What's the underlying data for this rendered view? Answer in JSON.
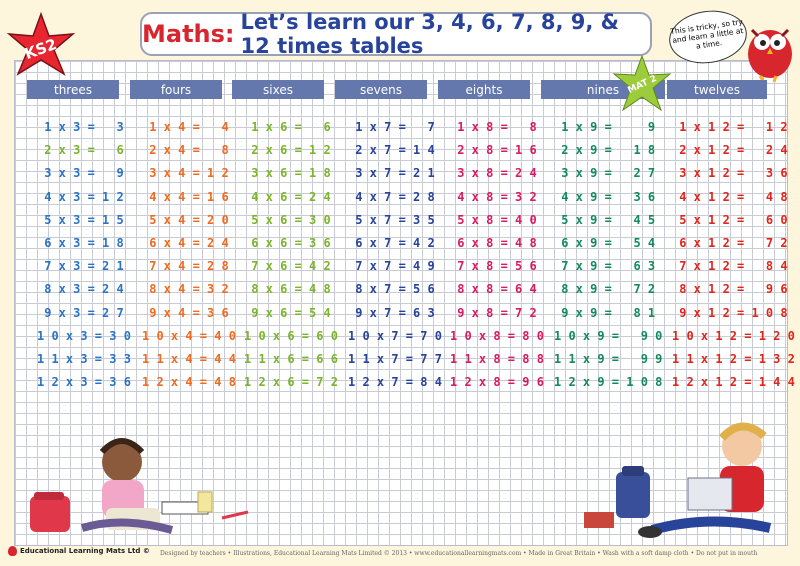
{
  "title": {
    "subject": "Maths:",
    "text": "Let’s learn our 3, 4, 6, 7, 8, 9, & 12 times tables"
  },
  "badge_ks2": "KS2",
  "badge_mat": "MAT 2",
  "owl_speech": "This is tricky, so try and learn a little at a time.",
  "brand": "Educational Learning Mats Ltd ©",
  "credits": "Designed by teachers • Illustrations, Educational Learning Mats Limited © 2013 • www.educationallearningmats.com • Made in Great Britain • Wash with a soft damp cloth • Do not put in mouth",
  "colors": {
    "blue": "#2b73c4",
    "orange": "#ef6b1f",
    "green": "#7ab52b",
    "navy": "#27439a",
    "magenta": "#d81b60",
    "teal": "#148a5c",
    "red": "#e0251b",
    "header": "#6478ad"
  },
  "columns": [
    {
      "header": "threes",
      "rows": [
        {
          "text": " 1 x 3 =   3",
          "color": "blue"
        },
        {
          "text": " 2 x 3 =   6",
          "color": "green"
        },
        {
          "text": " 3 x 3 =   9",
          "color": "blue"
        },
        {
          "text": " 4 x 3 = 1 2",
          "color": "blue"
        },
        {
          "text": " 5 x 3 = 1 5",
          "color": "blue"
        },
        {
          "text": " 6 x 3 = 1 8",
          "color": "blue"
        },
        {
          "text": " 7 x 3 = 2 1",
          "color": "blue"
        },
        {
          "text": " 8 x 3 = 2 4",
          "color": "blue"
        },
        {
          "text": " 9 x 3 = 2 7",
          "color": "blue"
        },
        {
          "text": "1 0 x 3 = 3 0",
          "color": "blue"
        },
        {
          "text": "1 1 x 3 = 3 3",
          "color": "blue"
        },
        {
          "text": "1 2 x 3 = 3 6",
          "color": "blue"
        }
      ]
    },
    {
      "header": "fours",
      "rows": [
        {
          "text": " 1 x 4 =   4",
          "color": "orange"
        },
        {
          "text": " 2 x 4 =   8",
          "color": "orange"
        },
        {
          "text": " 3 x 4 = 1 2",
          "color": "orange"
        },
        {
          "text": " 4 x 4 = 1 6",
          "color": "orange"
        },
        {
          "text": " 5 x 4 = 2 0",
          "color": "orange"
        },
        {
          "text": " 6 x 4 = 2 4",
          "color": "orange"
        },
        {
          "text": " 7 x 4 = 2 8",
          "color": "orange"
        },
        {
          "text": " 8 x 4 = 3 2",
          "color": "orange"
        },
        {
          "text": " 9 x 4 = 3 6",
          "color": "orange"
        },
        {
          "text": "1 0 x 4 = 4 0",
          "color": "orange"
        },
        {
          "text": "1 1 x 4 = 4 4",
          "color": "orange"
        },
        {
          "text": "1 2 x 4 = 4 8",
          "color": "orange"
        }
      ]
    },
    {
      "header": "sixes",
      "rows": [
        {
          "text": " 1 x 6 =   6",
          "color": "green"
        },
        {
          "text": " 2 x 6 = 1 2",
          "color": "green"
        },
        {
          "text": " 3 x 6 = 1 8",
          "color": "green"
        },
        {
          "text": " 4 x 6 = 2 4",
          "color": "green"
        },
        {
          "text": " 5 x 6 = 3 0",
          "color": "green"
        },
        {
          "text": " 6 x 6 = 3 6",
          "color": "green"
        },
        {
          "text": " 7 x 6 = 4 2",
          "color": "green"
        },
        {
          "text": " 8 x 6 = 4 8",
          "color": "green"
        },
        {
          "text": " 9 x 6 = 5 4",
          "color": "green"
        },
        {
          "text": "1 0 x 6 = 6 0",
          "color": "green"
        },
        {
          "text": "1 1 x 6 = 6 6",
          "color": "green"
        },
        {
          "text": "1 2 x 6 = 7 2",
          "color": "green"
        }
      ]
    },
    {
      "header": "sevens",
      "rows": [
        {
          "text": " 1 x 7 =   7",
          "color": "navy"
        },
        {
          "text": " 2 x 7 = 1 4",
          "color": "navy"
        },
        {
          "text": " 3 x 7 = 2 1",
          "color": "navy"
        },
        {
          "text": " 4 x 7 = 2 8",
          "color": "navy"
        },
        {
          "text": " 5 x 7 = 3 5",
          "color": "navy"
        },
        {
          "text": " 6 x 7 = 4 2",
          "color": "navy"
        },
        {
          "text": " 7 x 7 = 4 9",
          "color": "navy"
        },
        {
          "text": " 8 x 7 = 5 6",
          "color": "navy"
        },
        {
          "text": " 9 x 7 = 6 3",
          "color": "navy"
        },
        {
          "text": "1 0 x 7 = 7 0",
          "color": "navy"
        },
        {
          "text": "1 1 x 7 = 7 7",
          "color": "navy"
        },
        {
          "text": "1 2 x 7 = 8 4",
          "color": "navy"
        }
      ]
    },
    {
      "header": "eights",
      "rows": [
        {
          "text": " 1 x 8 =   8",
          "color": "magenta"
        },
        {
          "text": " 2 x 8 = 1 6",
          "color": "magenta"
        },
        {
          "text": " 3 x 8 = 2 4",
          "color": "magenta"
        },
        {
          "text": " 4 x 8 = 3 2",
          "color": "magenta"
        },
        {
          "text": " 5 x 8 = 4 0",
          "color": "magenta"
        },
        {
          "text": " 6 x 8 = 4 8",
          "color": "magenta"
        },
        {
          "text": " 7 x 8 = 5 6",
          "color": "magenta"
        },
        {
          "text": " 8 x 8 = 6 4",
          "color": "magenta"
        },
        {
          "text": " 9 x 8 = 7 2",
          "color": "magenta"
        },
        {
          "text": "1 0 x 8 = 8 0",
          "color": "magenta"
        },
        {
          "text": "1 1 x 8 = 8 8",
          "color": "magenta"
        },
        {
          "text": "1 2 x 8 = 9 6",
          "color": "magenta"
        }
      ]
    },
    {
      "header": "nines",
      "rows": [
        {
          "text": " 1 x 9 =     9",
          "color": "teal"
        },
        {
          "text": " 2 x 9 =   1 8",
          "color": "teal"
        },
        {
          "text": " 3 x 9 =   2 7",
          "color": "teal"
        },
        {
          "text": " 4 x 9 =   3 6",
          "color": "teal"
        },
        {
          "text": " 5 x 9 =   4 5",
          "color": "teal"
        },
        {
          "text": " 6 x 9 =   5 4",
          "color": "teal"
        },
        {
          "text": " 7 x 9 =   6 3",
          "color": "teal"
        },
        {
          "text": " 8 x 9 =   7 2",
          "color": "teal"
        },
        {
          "text": " 9 x 9 =   8 1",
          "color": "teal"
        },
        {
          "text": "1 0 x 9 =   9 0",
          "color": "teal"
        },
        {
          "text": "1 1 x 9 =   9 9",
          "color": "teal"
        },
        {
          "text": "1 2 x 9 = 1 0 8",
          "color": "teal"
        }
      ]
    },
    {
      "header": "twelves",
      "rows": [
        {
          "text": " 1 x 1 2 =   1 2",
          "color": "red"
        },
        {
          "text": " 2 x 1 2 =   2 4",
          "color": "red"
        },
        {
          "text": " 3 x 1 2 =   3 6",
          "color": "red"
        },
        {
          "text": " 4 x 1 2 =   4 8",
          "color": "red"
        },
        {
          "text": " 5 x 1 2 =   6 0",
          "color": "red"
        },
        {
          "text": " 6 x 1 2 =   7 2",
          "color": "red"
        },
        {
          "text": " 7 x 1 2 =   8 4",
          "color": "red"
        },
        {
          "text": " 8 x 1 2 =   9 6",
          "color": "red"
        },
        {
          "text": " 9 x 1 2 = 1 0 8",
          "color": "red"
        },
        {
          "text": "1 0 x 1 2 = 1 2 0",
          "color": "red"
        },
        {
          "text": "1 1 x 1 2 = 1 3 2",
          "color": "red"
        },
        {
          "text": "1 2 x 1 2 = 1 4 4",
          "color": "red"
        }
      ]
    }
  ]
}
